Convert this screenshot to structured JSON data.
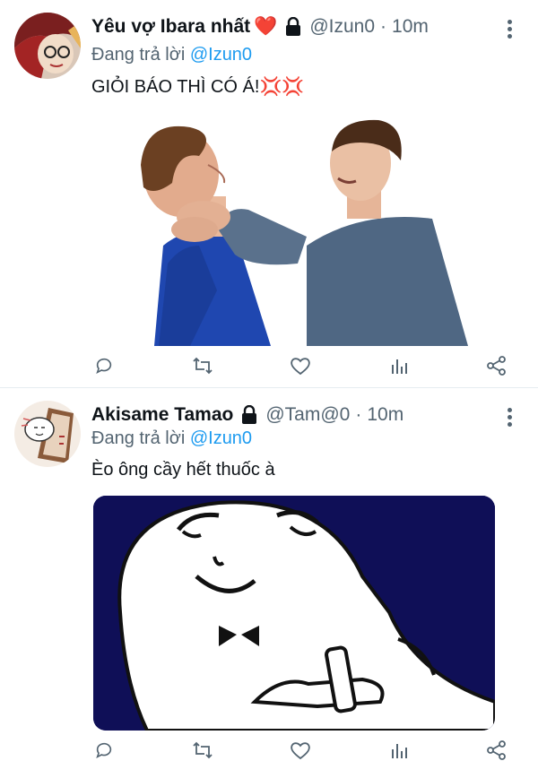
{
  "tweets": [
    {
      "display_name": "Yêu vợ Ibara nhất",
      "heart": "❤️",
      "handle": "@Izun0",
      "separator": "·",
      "time": "10m",
      "reply_prefix": "Đang trả lời ",
      "reply_to": "@Izun0",
      "text": "GIỎI BÁO THÌ CÓ Á!💢💢",
      "media": "photo of one young man choking another",
      "actions": [
        "reply-icon",
        "retweet-icon",
        "like-icon",
        "analytics-icon",
        "share-icon"
      ]
    },
    {
      "display_name": "Akisame Tamao",
      "handle": "@Tam@0",
      "separator": "·",
      "time": "10m",
      "reply_prefix": "Đang trả lời ",
      "reply_to": "@Izun0",
      "text": "Èo ông cầy hết thuốc à",
      "media": "cartoon meme face on dark navy background",
      "actions": [
        "reply-icon",
        "retweet-icon",
        "like-icon",
        "analytics-icon",
        "share-icon"
      ]
    }
  ],
  "colors": {
    "accent": "#1d9bf0",
    "secondary_text": "#536471",
    "heart": "#e0245e",
    "meme_bg": "#0f0f57"
  }
}
